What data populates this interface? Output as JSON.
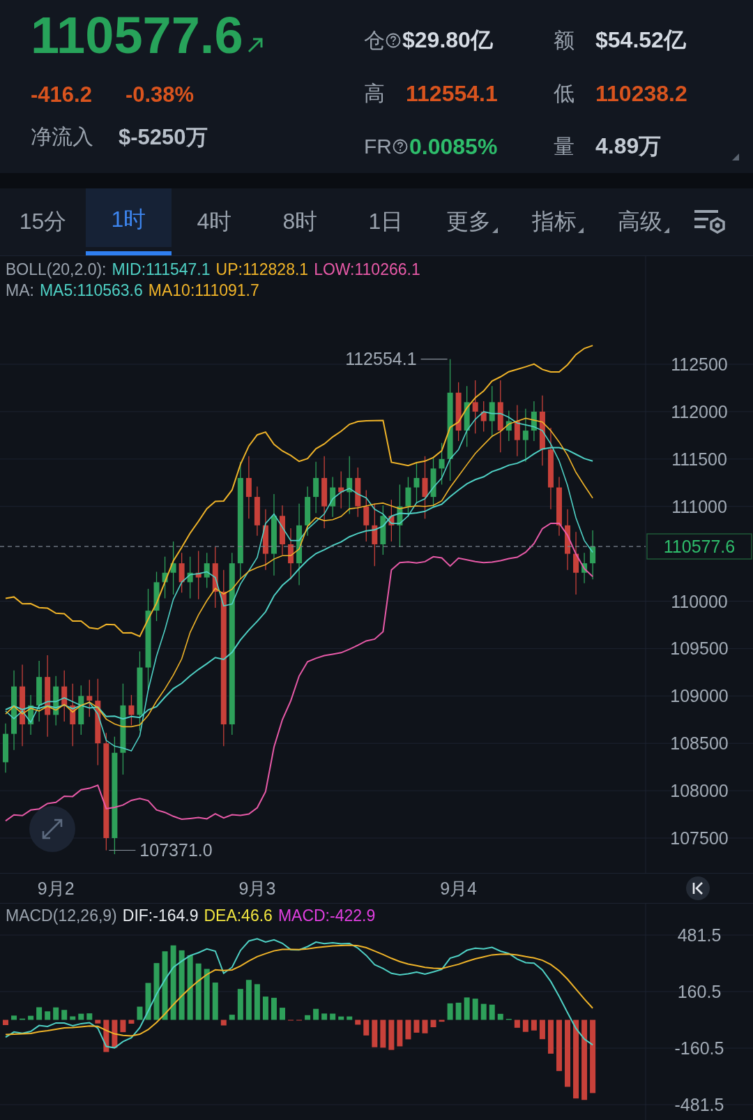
{
  "header": {
    "price": "110577.6",
    "change": "-416.2",
    "change_pct": "-0.38%",
    "net_inflow": {
      "label": "净流入",
      "value": "$-5250万"
    },
    "stats": [
      {
        "label": "仓",
        "info_icon": true,
        "value": "$29.80亿",
        "color": "#d5dbe3"
      },
      {
        "label": "额",
        "info_icon": false,
        "value": "$54.52亿",
        "color": "#d5dbe3"
      },
      {
        "label": "高",
        "info_icon": false,
        "value": "112554.1",
        "color": "#d9541e"
      },
      {
        "label": "低",
        "info_icon": false,
        "value": "110238.2",
        "color": "#d9541e"
      },
      {
        "label": "FR",
        "info_icon": true,
        "value": "0.0085%",
        "color": "#2ebd6b"
      },
      {
        "label": "量",
        "info_icon": false,
        "value": "4.89万",
        "color": "#c3cad3"
      }
    ]
  },
  "tabs": [
    {
      "label": "15分",
      "selected": false,
      "dropdown": false
    },
    {
      "label": "1时",
      "selected": true,
      "dropdown": false
    },
    {
      "label": "4时",
      "selected": false,
      "dropdown": false
    },
    {
      "label": "8时",
      "selected": false,
      "dropdown": false
    },
    {
      "label": "1日",
      "selected": false,
      "dropdown": false
    },
    {
      "label": "更多",
      "selected": false,
      "dropdown": true
    },
    {
      "label": "指标",
      "selected": false,
      "dropdown": true
    },
    {
      "label": "高级",
      "selected": false,
      "dropdown": true
    }
  ],
  "main_chart": {
    "boll": {
      "label": "BOLL(20,2.0):",
      "items": [
        {
          "text": "MID:111547.1",
          "color": "#4fd1c5"
        },
        {
          "text": "UP:112828.1",
          "color": "#f0b429"
        },
        {
          "text": "LOW:110266.1",
          "color": "#e85aa8"
        }
      ]
    },
    "ma": {
      "label": "MA:",
      "items": [
        {
          "text": "MA5:110563.6",
          "color": "#4fd1c5"
        },
        {
          "text": "MA10:111091.7",
          "color": "#f0b429"
        }
      ]
    },
    "y_ticks": [
      "112500",
      "112000",
      "111500",
      "111000",
      "110000",
      "109500",
      "109000",
      "108500",
      "108000",
      "107500"
    ],
    "current_price": "110577.6",
    "high_marker": "112554.1",
    "low_marker": "107371.0",
    "dates": [
      "9月2",
      "9月3",
      "9月4"
    ]
  },
  "macd": {
    "label": "MACD(12,26,9)",
    "items": [
      {
        "text": "DIF:-164.9",
        "color": "#e8ecf0"
      },
      {
        "text": "DEA:46.6",
        "color": "#f2e640"
      },
      {
        "text": "MACD:-422.9",
        "color": "#e03fe0"
      }
    ],
    "y_ticks": [
      "481.5",
      "160.5",
      "-160.5",
      "-481.5"
    ]
  }
}
